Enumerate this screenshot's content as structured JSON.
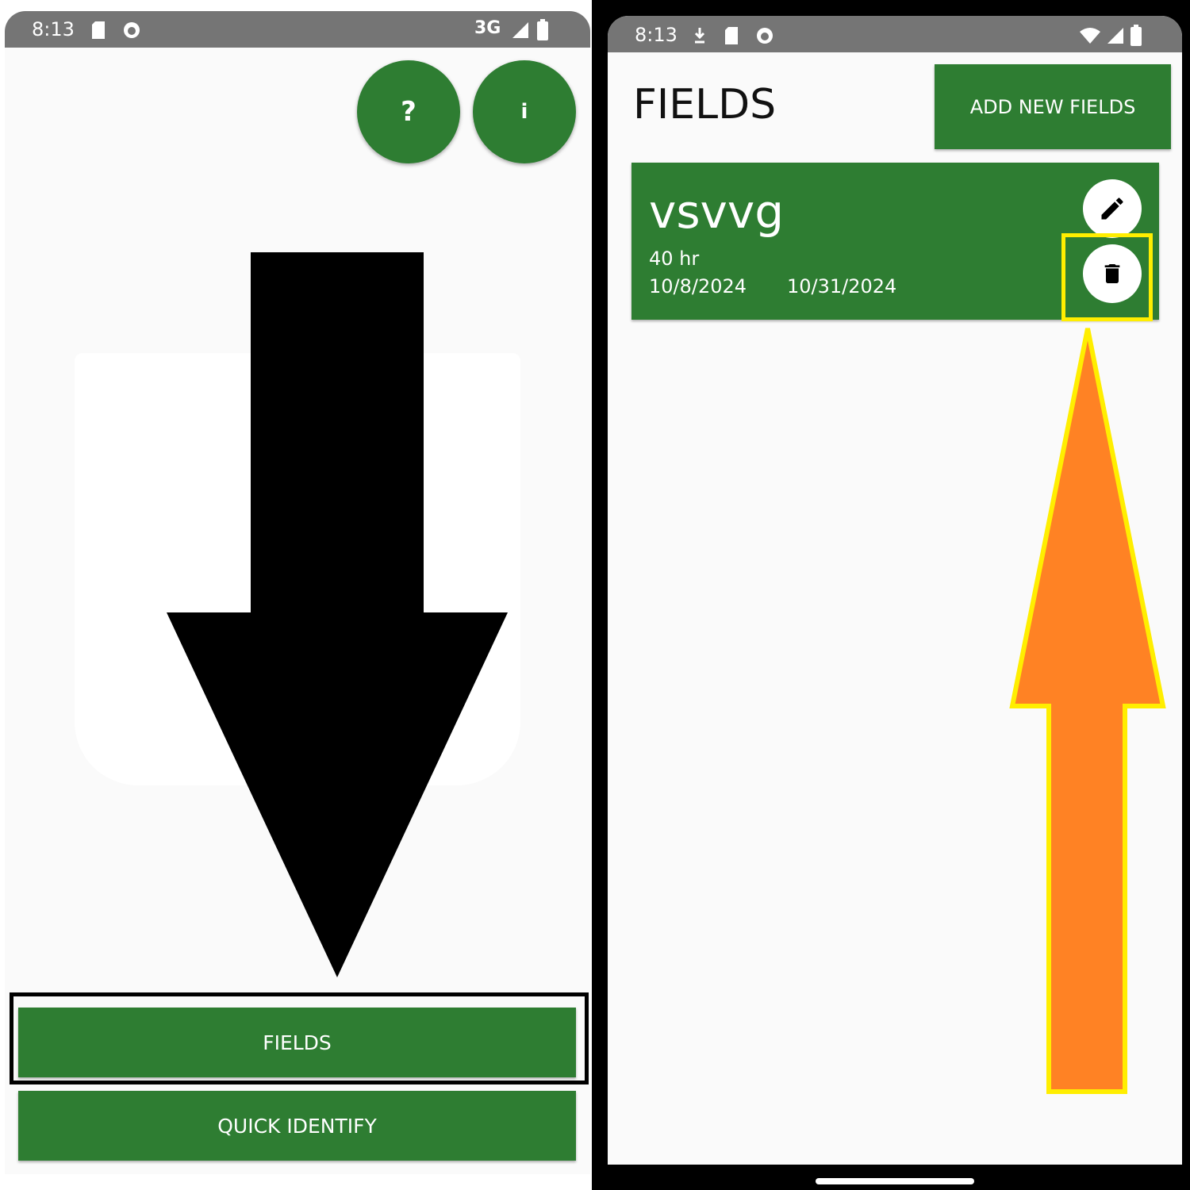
{
  "left_screen": {
    "status": {
      "time": "8:13",
      "network": "3G"
    },
    "help_button_label": "?",
    "info_button_label": "i",
    "fields_button_label": "FIELDS",
    "quick_identify_label": "QUICK IDENTIFY"
  },
  "right_screen": {
    "status": {
      "time": "8:13"
    },
    "page_title": "FIELDS",
    "add_button_label": "ADD NEW FIELDS",
    "field_card": {
      "name": "vsvvg",
      "duration": "40 hr",
      "start_date": "10/8/2024",
      "end_date": "10/31/2024"
    }
  },
  "colors": {
    "primary_green": "#2e7d32",
    "status_bar": "#757575",
    "screen_bg": "#fafafa",
    "highlight_yellow": "#ffee00",
    "arrow_orange": "#ff8224",
    "arrow_black": "#000000"
  },
  "icons": [
    "sd-card-icon",
    "app-icon",
    "signal-icon",
    "battery-icon",
    "wifi-icon",
    "download-icon",
    "edit-pencil-icon",
    "trash-icon"
  ]
}
